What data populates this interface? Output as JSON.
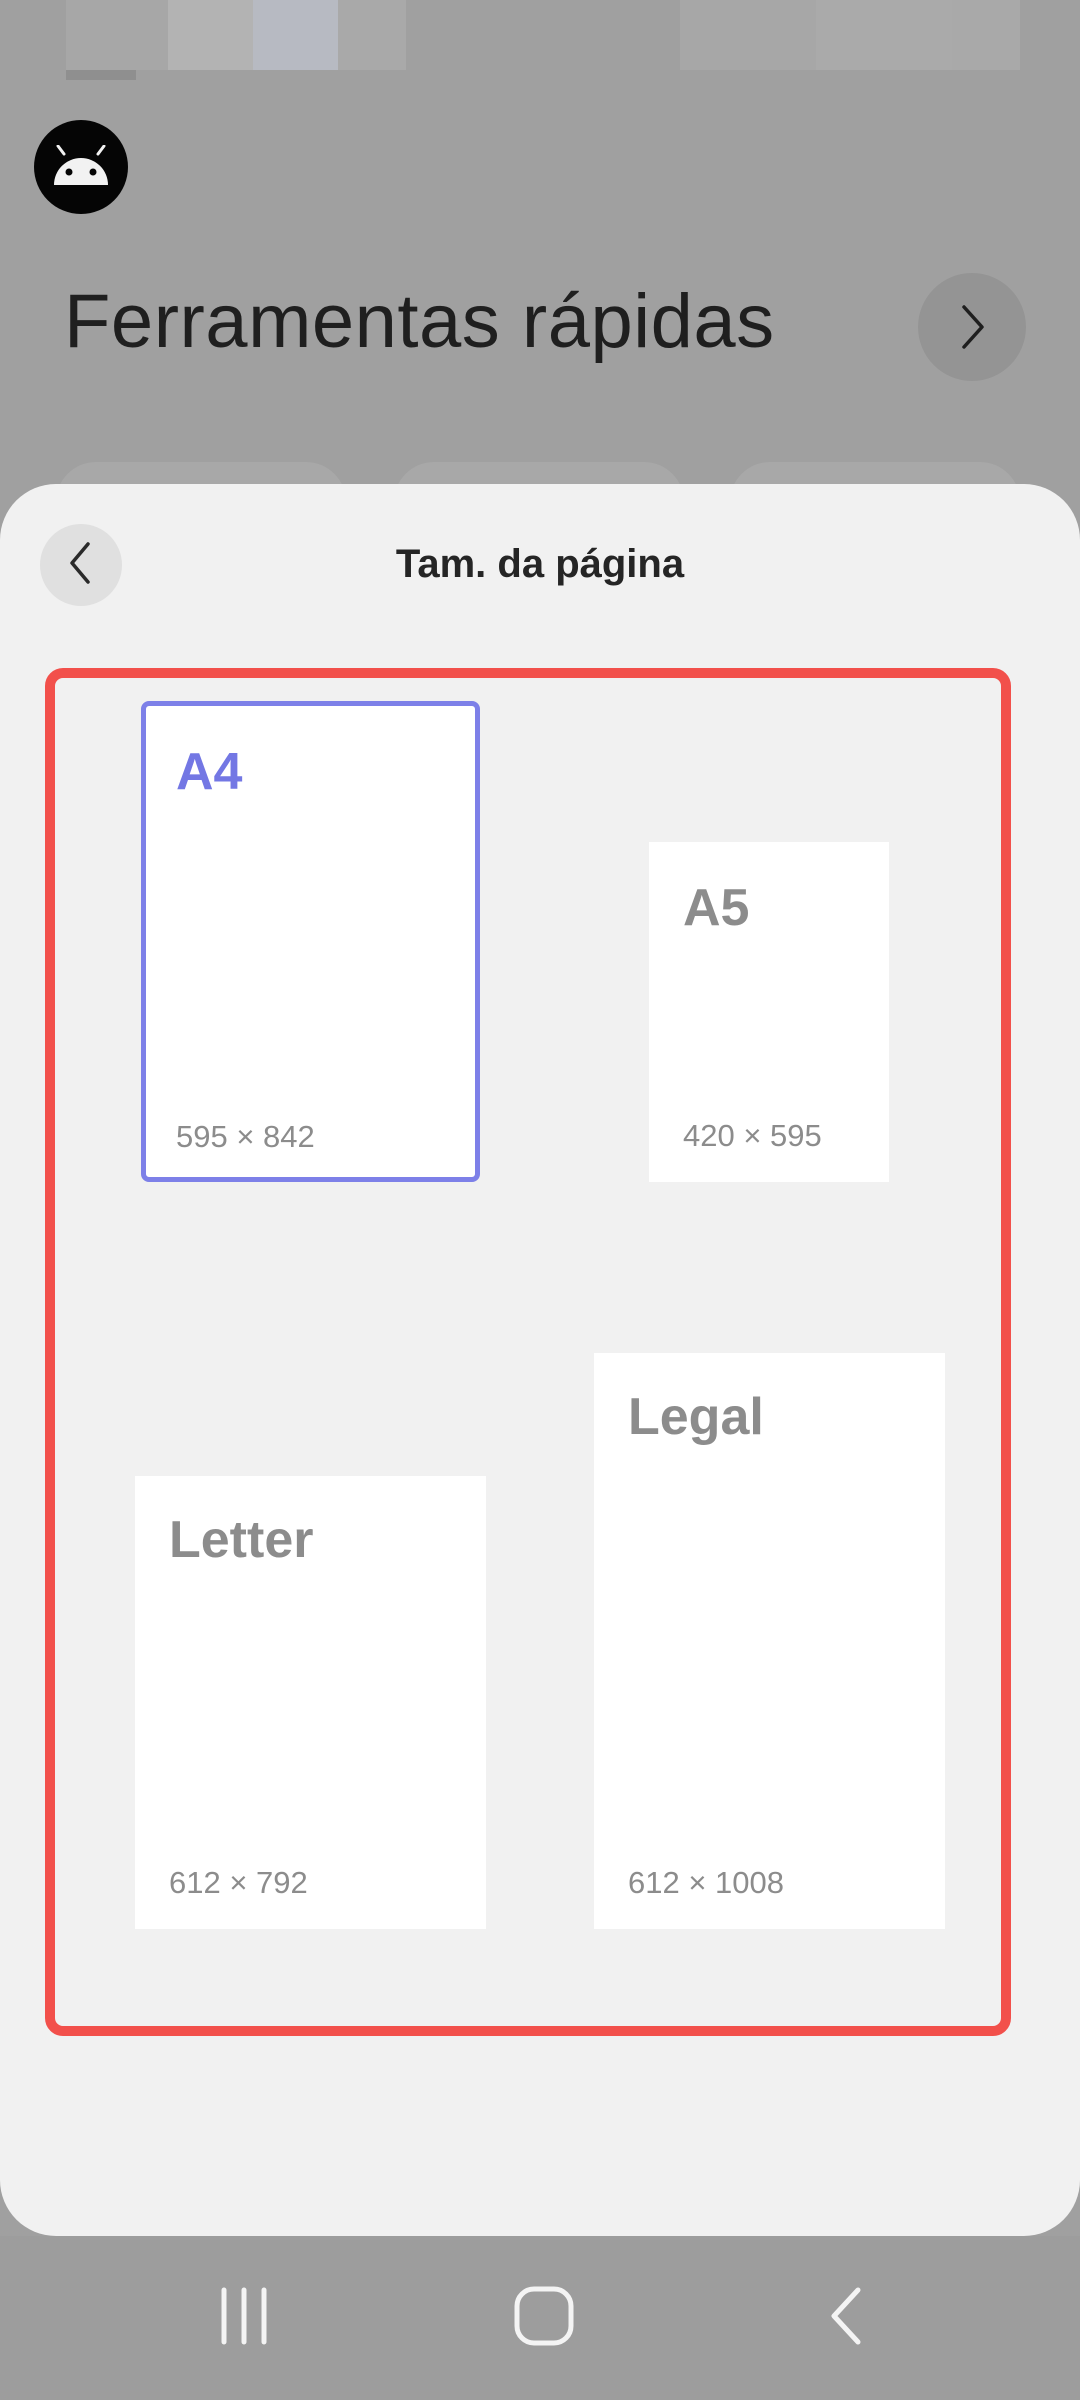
{
  "background": {
    "title": "Ferramentas rápidas",
    "app_icon": "android-icon",
    "next_icon": "chevron-right-icon"
  },
  "sheet": {
    "title": "Tam. da página",
    "back_icon": "chevron-left-icon",
    "highlight_color": "#f2504b",
    "selected_color": "#7377e4",
    "page_sizes": [
      {
        "name": "A4",
        "dims": "595 × 842",
        "selected": true
      },
      {
        "name": "A5",
        "dims": "420 × 595",
        "selected": false
      },
      {
        "name": "Letter",
        "dims": "612 × 792",
        "selected": false
      },
      {
        "name": "Legal",
        "dims": "612 × 1008",
        "selected": false
      }
    ]
  },
  "navbar": {
    "recents_icon": "recents-icon",
    "home_icon": "home-icon",
    "back_icon": "back-icon"
  }
}
